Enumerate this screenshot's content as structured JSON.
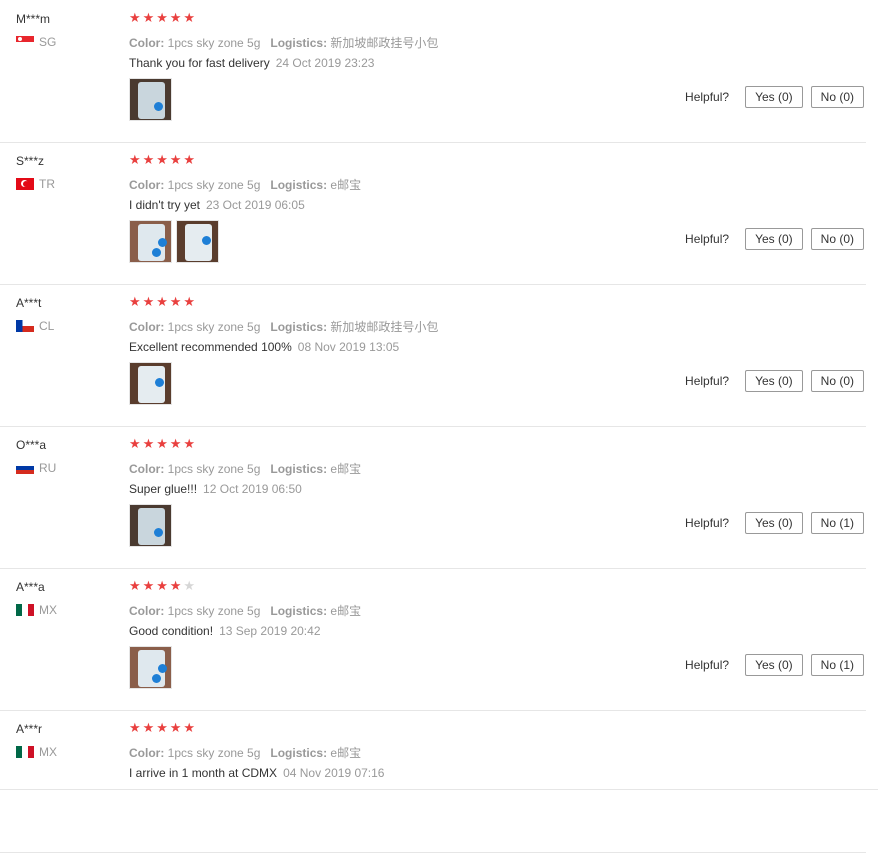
{
  "labels": {
    "color": "Color:",
    "logistics": "Logistics:",
    "helpful": "Helpful?"
  },
  "reviews": [
    {
      "user": "M***m",
      "country": "SG",
      "rating": 5,
      "color": "1pcs sky zone 5g",
      "logistics": "新加坡邮政挂号小包",
      "text": "Thank you for fast delivery",
      "date": "24 Oct 2019 23:23",
      "photos": 1,
      "yes": "Yes (0)",
      "no": "No (0)"
    },
    {
      "user": "S***z",
      "country": "TR",
      "rating": 5,
      "color": "1pcs sky zone 5g",
      "logistics": "e邮宝",
      "text": "I didn't try yet",
      "date": "23 Oct 2019 06:05",
      "photos": 2,
      "yes": "Yes (0)",
      "no": "No (0)"
    },
    {
      "user": "A***t",
      "country": "CL",
      "rating": 5,
      "color": "1pcs sky zone 5g",
      "logistics": "新加坡邮政挂号小包",
      "text": "Excellent recommended 100%",
      "date": "08 Nov 2019 13:05",
      "photos": 1,
      "yes": "Yes (0)",
      "no": "No (0)"
    },
    {
      "user": "O***a",
      "country": "RU",
      "rating": 5,
      "color": "1pcs sky zone 5g",
      "logistics": "e邮宝",
      "text": "Super glue!!!",
      "date": "12 Oct 2019 06:50",
      "photos": 1,
      "yes": "Yes (0)",
      "no": "No (1)"
    },
    {
      "user": "A***a",
      "country": "MX",
      "rating": 4,
      "color": "1pcs sky zone 5g",
      "logistics": "e邮宝",
      "text": "Good condition!",
      "date": "13 Sep 2019 20:42",
      "photos": 1,
      "yes": "Yes (0)",
      "no": "No (1)"
    },
    {
      "user": "A***r",
      "country": "MX",
      "rating": 5,
      "color": "1pcs sky zone 5g",
      "logistics": "e邮宝",
      "text": "I arrive in 1 month at CDMX",
      "date": "04 Nov 2019 07:16",
      "photos": 0,
      "yes": "",
      "no": ""
    }
  ],
  "colors": {
    "star_on": "#e9403f",
    "star_off": "#d6d6d6",
    "muted_text": "#999999",
    "text": "#333333",
    "divider": "#e6e6e6"
  }
}
